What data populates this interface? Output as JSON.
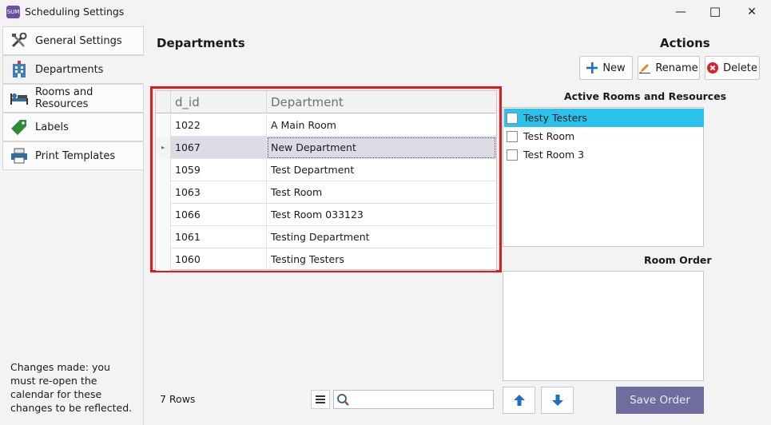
{
  "window": {
    "app_icon_text": "SUM",
    "title": "Scheduling Settings",
    "minimize": "—",
    "maximize": "☐",
    "close": "✕"
  },
  "sidebar": {
    "items": [
      {
        "label": "General Settings",
        "icon": "tools-icon"
      },
      {
        "label": "Departments",
        "icon": "building-icon"
      },
      {
        "label": "Rooms and Resources",
        "icon": "bed-icon"
      },
      {
        "label": "Labels",
        "icon": "tag-icon"
      },
      {
        "label": "Print Templates",
        "icon": "printer-icon"
      }
    ],
    "selected": "Departments",
    "note": "Changes made: you must re-open the calendar for these changes to be reflected."
  },
  "main": {
    "heading": "Departments",
    "actions_heading": "Actions",
    "buttons": {
      "new": "New",
      "rename": "Rename",
      "delete": "Delete"
    }
  },
  "grid": {
    "columns": [
      "d_id",
      "Department"
    ],
    "rows": [
      {
        "d_id": "1022",
        "department": "A Main Room"
      },
      {
        "d_id": "1067",
        "department": "New Department"
      },
      {
        "d_id": "1059",
        "department": "Test Department"
      },
      {
        "d_id": "1063",
        "department": "Test Room"
      },
      {
        "d_id": "1066",
        "department": "Test Room 033123"
      },
      {
        "d_id": "1061",
        "department": "Testing Department"
      },
      {
        "d_id": "1060",
        "department": "Testing Testers"
      }
    ],
    "selected_row_indicator": "▸",
    "row_count_label": "7 Rows",
    "search_value": ""
  },
  "rooms": {
    "heading": "Active Rooms and Resources",
    "items": [
      {
        "label": "Testy Testers",
        "checked": false,
        "highlighted": true
      },
      {
        "label": "Test Room",
        "checked": false,
        "highlighted": false
      },
      {
        "label": "Test Room 3",
        "checked": false,
        "highlighted": false
      }
    ]
  },
  "room_order": {
    "heading": "Room Order",
    "save_label": "Save Order"
  },
  "colors": {
    "highlight": "#29c3ee",
    "grid_outline": "#e8141e",
    "save_button": "#6f6d9e",
    "selected_row": "#dcdbe6"
  }
}
